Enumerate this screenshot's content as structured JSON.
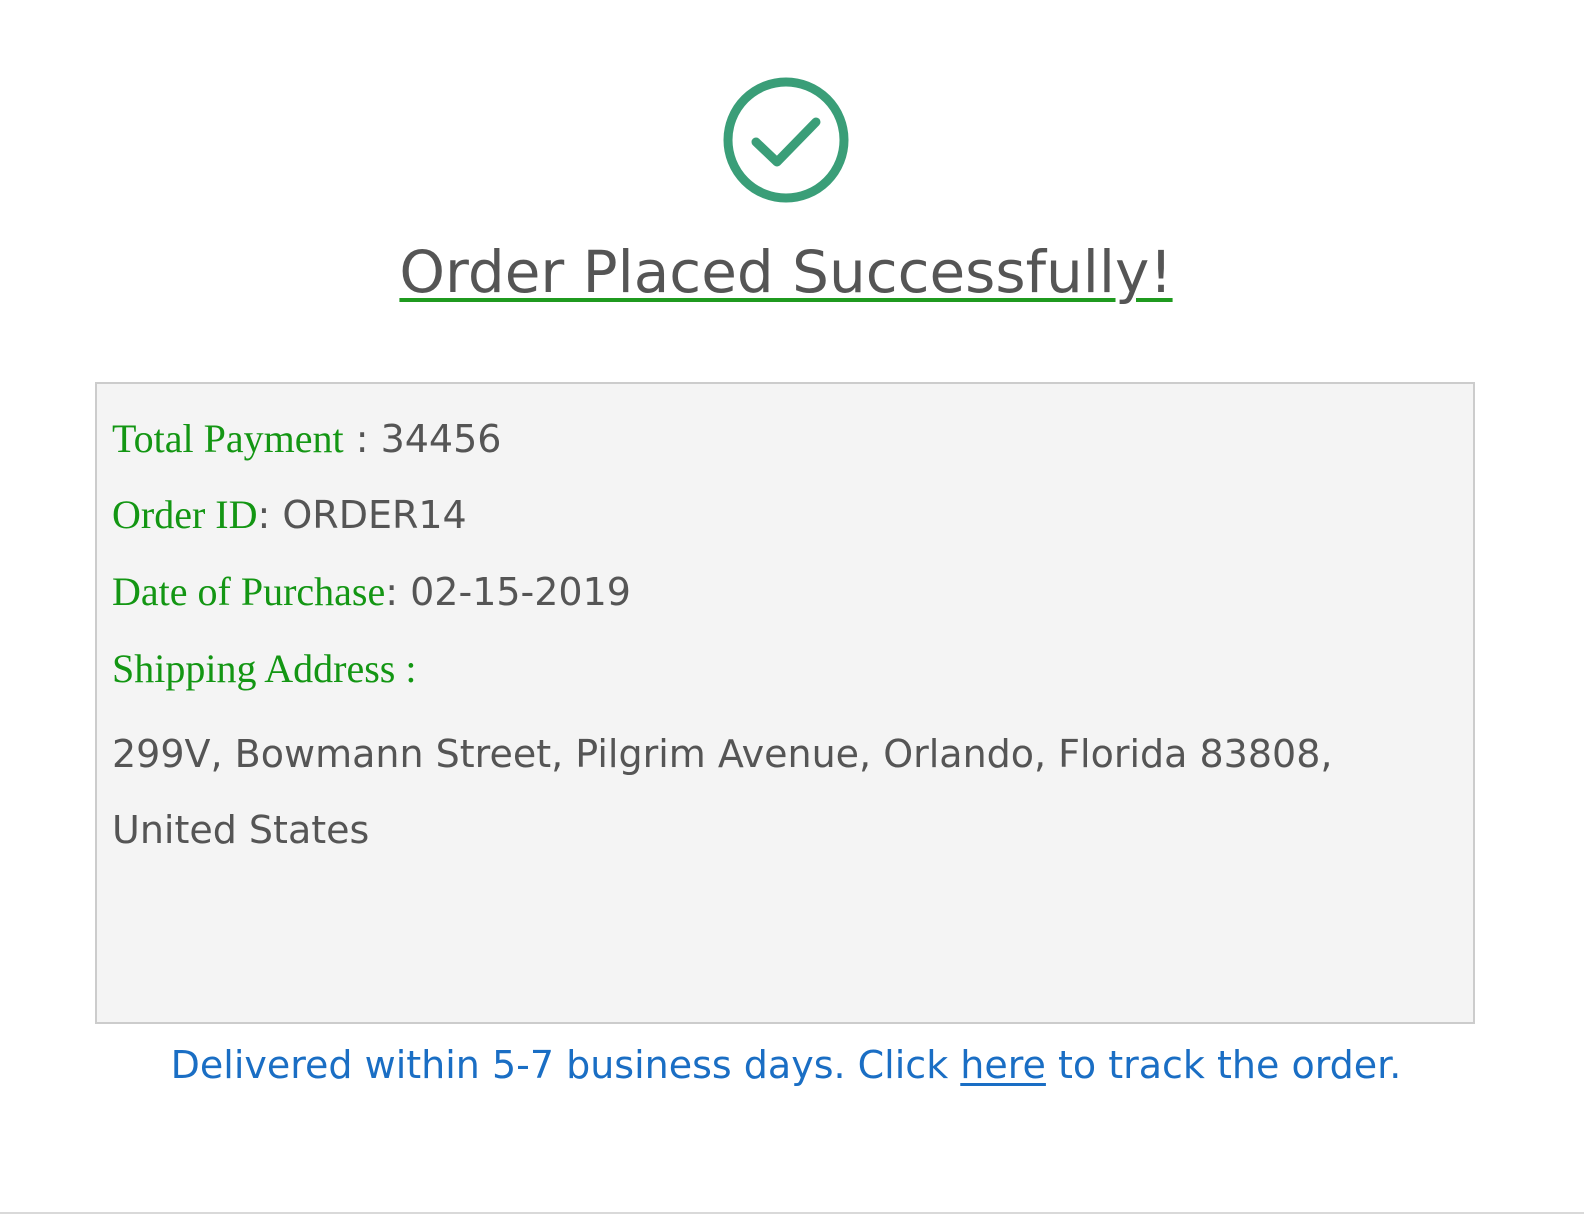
{
  "header": {
    "icon": "checkmark-circle-icon",
    "title": "Order Placed Successfully!"
  },
  "order": {
    "total_payment_label": "Total Payment",
    "total_payment_sep": " : ",
    "total_payment_value": "34456",
    "order_id_label": "Order ID",
    "order_id_sep": ": ",
    "order_id_value": "ORDER14",
    "date_label": "Date of Purchase",
    "date_sep": ": ",
    "date_value": "02-15-2019",
    "shipping_label": "Shipping Address",
    "shipping_sep": " :",
    "shipping_address": "299V, Bowmann Street, Pilgrim Avenue, Orlando, Florida 83808, United States"
  },
  "delivery": {
    "prefix": "Delivered within 5-7 business days. Click ",
    "link_text": "here",
    "suffix": " to track the order."
  },
  "colors": {
    "success_green": "#3a9e78",
    "label_green": "#139613",
    "link_blue": "#1a6ec4",
    "text_gray": "#555555",
    "box_bg": "#f4f4f4",
    "box_border": "#cccccc"
  }
}
